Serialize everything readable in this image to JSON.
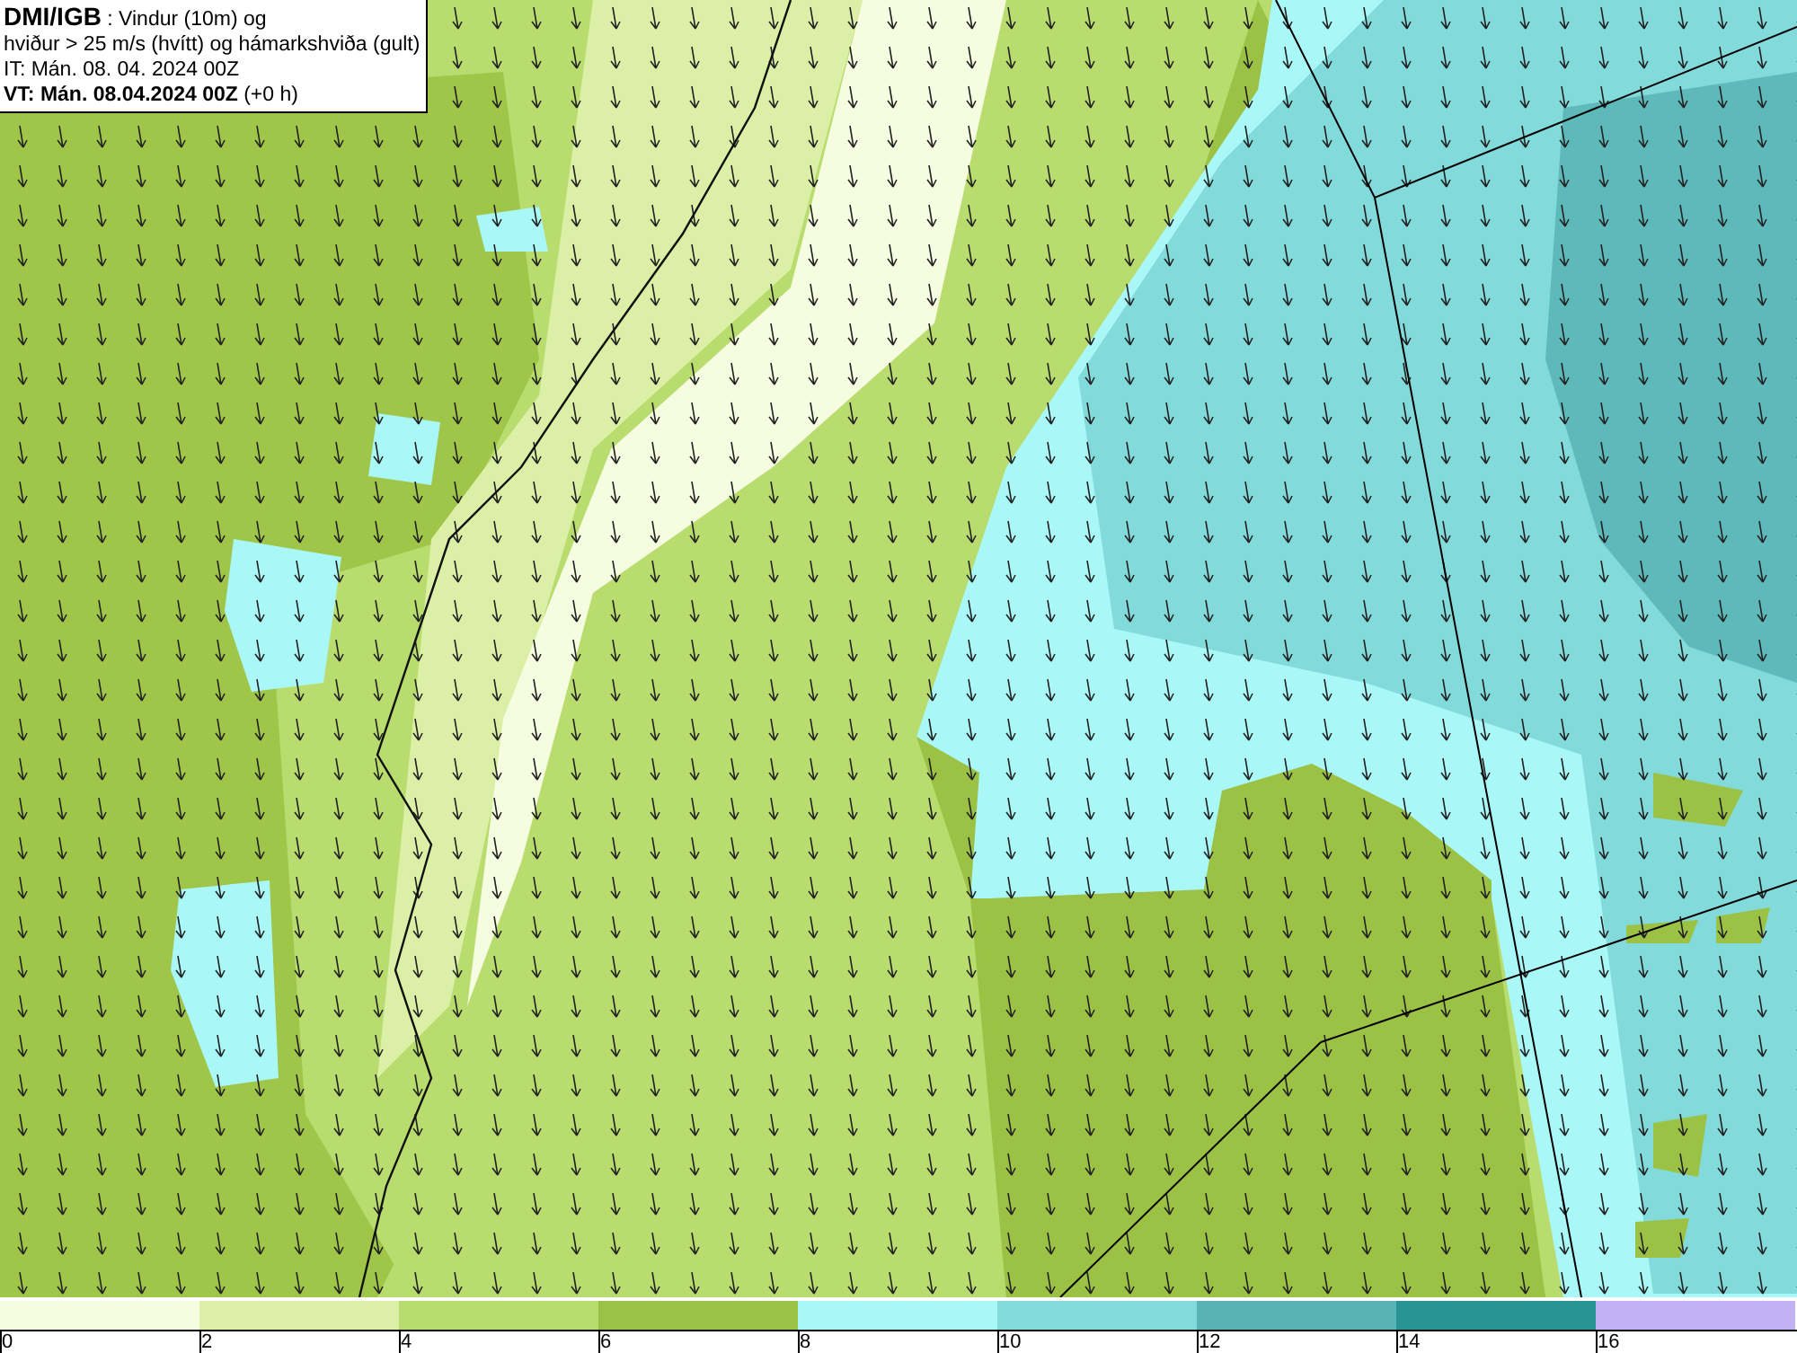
{
  "header": {
    "lines": [
      "**DMI/IGB** : Vindur (10m) og",
      "hviður > 25 m/s (hvítt) og hámarkshviða (gult)",
      "IT: Mán. 08. 04. 2024 00Z",
      "**VT: Mán. 08.04.2024 00Z** (+0 h)"
    ]
  },
  "legend": {
    "classes": [
      {
        "color": "#f5fce0"
      },
      {
        "color": "#dbf0a6"
      },
      {
        "color": "#b8dc6e"
      },
      {
        "color": "#9cc245"
      },
      {
        "color": "#aaf7f7"
      },
      {
        "color": "#83dada"
      },
      {
        "color": "#58b4b4"
      },
      {
        "color": "#2a9494"
      },
      {
        "color": "#c2b0f5"
      }
    ],
    "ticks": [
      "0",
      "2",
      "4",
      "6",
      "8",
      "10",
      "12",
      "14",
      "16"
    ]
  }
}
